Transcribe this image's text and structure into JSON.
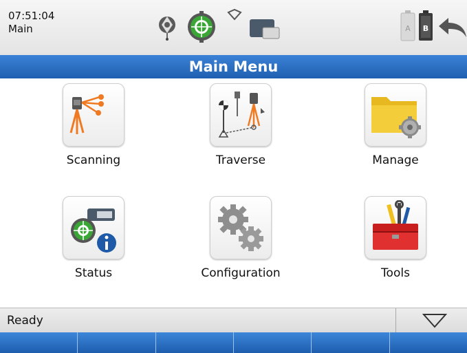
{
  "status": {
    "time": "07:51:04",
    "context": "Main",
    "icons": [
      "laser-icon",
      "target-prism-icon",
      "radio-icon",
      "controller-icon",
      "battery-a-icon",
      "battery-b-icon",
      "back-arrow-icon"
    ],
    "battery_a_label": "A",
    "battery_b_label": "B"
  },
  "title": "Main Menu",
  "menu": {
    "items": [
      {
        "label": "Scanning",
        "icon": "scanning-icon"
      },
      {
        "label": "Traverse",
        "icon": "traverse-icon"
      },
      {
        "label": "Manage",
        "icon": "manage-folder-icon"
      },
      {
        "label": "Status",
        "icon": "status-info-icon"
      },
      {
        "label": "Configuration",
        "icon": "configuration-gears-icon"
      },
      {
        "label": "Tools",
        "icon": "toolbox-icon"
      }
    ]
  },
  "footer": {
    "status_text": "Ready",
    "dropdown_icon": "triangle-down-icon",
    "softkeys": [
      "",
      "",
      "",
      "",
      "",
      ""
    ]
  },
  "colors": {
    "title_bar": "#2b70c4",
    "softkey": "#2a6fc2",
    "accent_orange": "#f07a22",
    "accent_green": "#3aa635"
  }
}
